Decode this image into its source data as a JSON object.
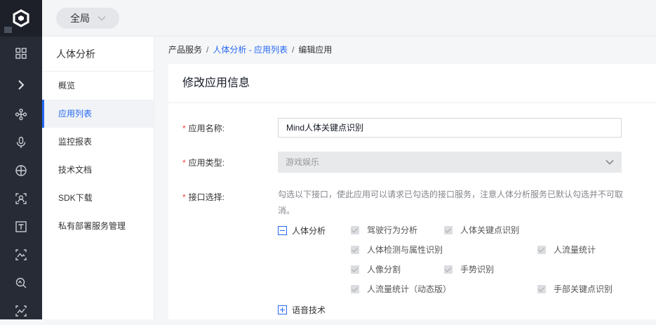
{
  "rail": {
    "icons": [
      "logo-icon",
      "grid-icon",
      "chevron-right-icon",
      "nodes-icon",
      "microphone-icon",
      "globe-icon",
      "face-scan-icon",
      "text-icon",
      "image-analysis-icon",
      "search-analysis-icon",
      "image-chart-icon"
    ]
  },
  "topbar": {
    "scope_label": "全局"
  },
  "sidebar": {
    "title": "人体分析",
    "items": [
      {
        "label": "概览"
      },
      {
        "label": "应用列表"
      },
      {
        "label": "监控报表"
      },
      {
        "label": "技术文档"
      },
      {
        "label": "SDK下载"
      },
      {
        "label": "私有部署服务管理"
      }
    ]
  },
  "breadcrumb": {
    "root": "产品服务",
    "sep": "/",
    "parent": "人体分析 - 应用列表",
    "current": "编辑应用"
  },
  "form": {
    "title": "修改应用信息",
    "required_mark": "*",
    "name_label": "应用名称:",
    "name_value": "Mind人体关键点识别",
    "type_label": "应用类型:",
    "type_value": "游戏娱乐",
    "api_label": "接口选择:",
    "api_hint": "勾选以下接口，使此应用可以请求已勾选的接口服务，注意人体分析服务已默认勾选并不可取消。",
    "group_body": "人体分析",
    "group_speech": "语音技术",
    "checkboxes": [
      "驾驶行为分析",
      "人体关键点识别",
      "人体检测与属性识别",
      "人流量统计",
      "人像分割",
      "手势识别",
      "人流量统计（动态版）",
      "手部关键点识别"
    ]
  },
  "colors": {
    "accent": "#2468f2",
    "rail_bg": "#262b35",
    "required": "#f33e3e"
  }
}
